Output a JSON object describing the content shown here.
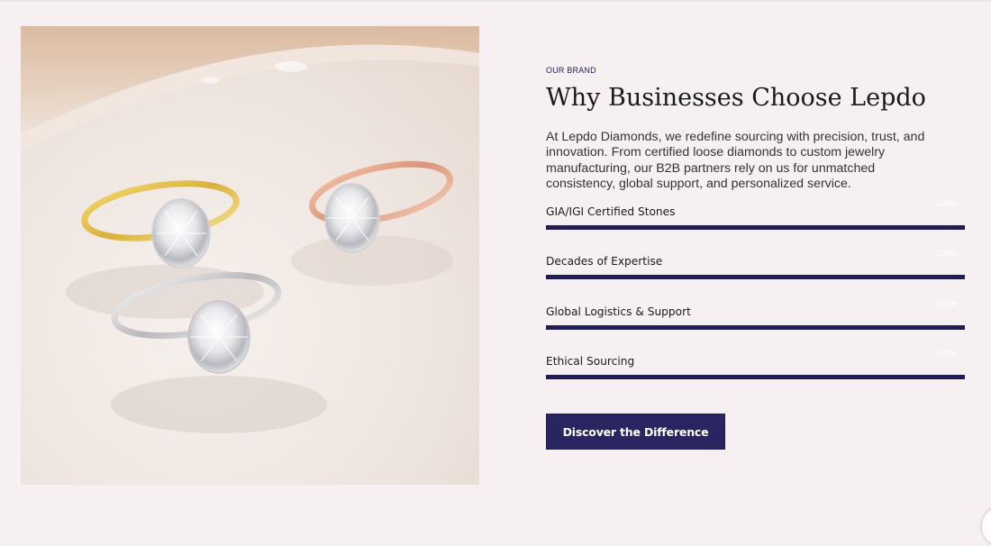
{
  "image": {
    "alt": "Three oval diamond engagement rings in yellow gold, rose gold and white gold"
  },
  "section": {
    "eyebrow": "OUR BRAND",
    "title": "Why Businesses Choose Lepdo",
    "description": "At Lepdo Diamonds, we redefine sourcing with precision, trust, and innovation. From certified loose diamonds to custom jewelry manufacturing, our B2B partners rely on us for unmatched consistency, global support, and personalized service."
  },
  "skills": [
    {
      "label": "GIA/IGI Certified Stones",
      "value": "100%",
      "percent": 100
    },
    {
      "label": "Decades of Expertise",
      "value": "100%",
      "percent": 100
    },
    {
      "label": "Global Logistics & Support",
      "value": "100%",
      "percent": 100
    },
    {
      "label": "Ethical Sourcing",
      "value": "100%",
      "percent": 100
    }
  ],
  "cta": {
    "label": "Discover the Difference"
  },
  "colors": {
    "background": "#f7f0f3",
    "accent": "#1f1d52",
    "button": "#292560"
  }
}
